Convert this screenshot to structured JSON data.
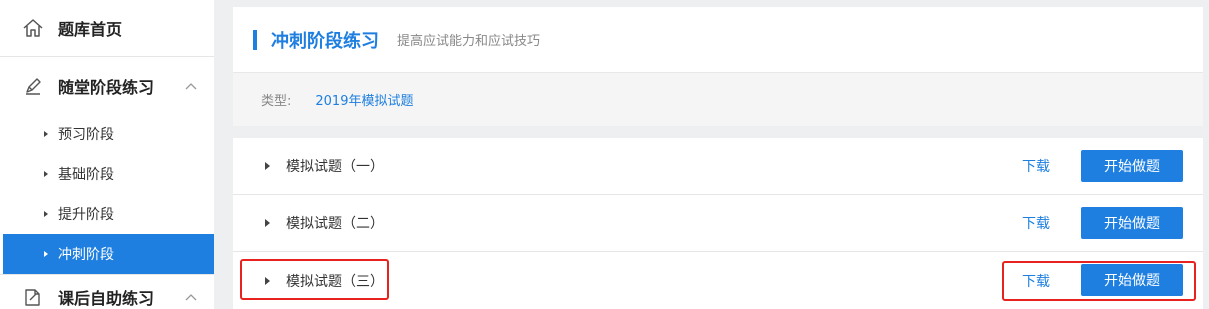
{
  "sidebar": {
    "home": {
      "label": "题库首页",
      "icon": "home-icon"
    },
    "groups": [
      {
        "label": "随堂阶段练习",
        "icon": "pencil-icon",
        "expanded": true,
        "items": [
          {
            "label": "预习阶段",
            "active": false
          },
          {
            "label": "基础阶段",
            "active": false
          },
          {
            "label": "提升阶段",
            "active": false
          },
          {
            "label": "冲刺阶段",
            "active": true
          }
        ]
      },
      {
        "label": "课后自助练习",
        "icon": "edit-document-icon",
        "expanded": true
      }
    ]
  },
  "header": {
    "title": "冲刺阶段练习",
    "subtitle": "提高应试能力和应试技巧",
    "type_label": "类型:",
    "type_value": "2019年模拟试题"
  },
  "exams": [
    {
      "name": "模拟试题（一）",
      "download_label": "下载",
      "start_label": "开始做题"
    },
    {
      "name": "模拟试题（二）",
      "download_label": "下载",
      "start_label": "开始做题"
    },
    {
      "name": "模拟试题（三）",
      "download_label": "下载",
      "start_label": "开始做题"
    }
  ],
  "colors": {
    "accent": "#1e7fe0",
    "highlight": "#e8231f",
    "background": "#eeeff1"
  }
}
